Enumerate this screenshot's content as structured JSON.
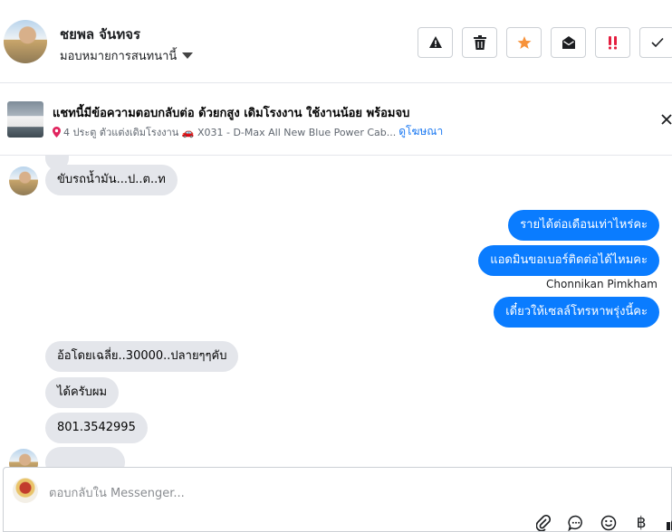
{
  "contact": {
    "name": "ชยพล จันทจร",
    "assign_label": "มอบหมายการสนทนานี้"
  },
  "actions": [
    {
      "name": "report-button",
      "icon": "warning-icon"
    },
    {
      "name": "delete-button",
      "icon": "trash-icon"
    },
    {
      "name": "star-button",
      "icon": "star-icon",
      "color": "#f7923a"
    },
    {
      "name": "mark-unread-button",
      "icon": "envelope-open-icon"
    },
    {
      "name": "follow-up-button",
      "icon": "double-exclamation-icon",
      "color": "#e41e3f"
    },
    {
      "name": "done-button",
      "icon": "checkmark-icon"
    }
  ],
  "ad": {
    "title": "แชทนี้มีข้อความตอบกลับต่อ ด้วยกสูง เดิมโรงงาน ใช้งานน้อย พร้อมจบ",
    "subtitle": "4 ประตู ตัวแต่งเดิมโรงงาน 🚗 X031 - D-Max All New Blue Power Cab...",
    "link": "ดูโฆษณา"
  },
  "messages": {
    "m1": "ขับรถน้ำมัน...ป..ต..ท",
    "m2": "รายได้ต่อเดือนเท่าไหร่คะ",
    "m3": "แอดมินขอเบอร์ติดต่อได้ไหมคะ",
    "sender_name": "Chonnikan Pimkham",
    "m4": "เดี๋ยวให้เซลล์โทรหาพรุ่งนี้คะ",
    "m5": "อ้อโดยเฉลี่ย..30000..ปลายๆๆคับ",
    "m6": "ได้ครับผม",
    "m7": "801.3542995"
  },
  "composer": {
    "placeholder": "ตอบกลับใน Messenger..."
  },
  "colors": {
    "outgoing_bubble": "#0a7cff",
    "incoming_bubble": "#e4e6eb",
    "link": "#1877f2"
  }
}
